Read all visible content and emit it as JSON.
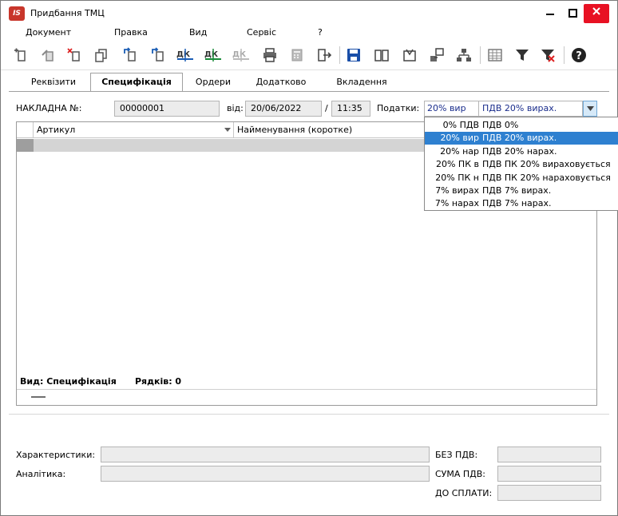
{
  "window": {
    "title": "Придбання ТМЦ",
    "logo_text": "IS",
    "icons": [
      "minimize-icon",
      "maximize-icon",
      "close-icon"
    ]
  },
  "menu": [
    "Документ",
    "Правка",
    "Вид",
    "Сервіс",
    "?"
  ],
  "toolbar": {
    "icons": [
      "new-doc-icon",
      "edit-doc-icon",
      "delete-doc-icon",
      "copy-doc-icon",
      "insert-doc-icon",
      "insert-doc-2-icon",
      "debit-credit-icon",
      "debit-credit-green-icon",
      "debit-credit-disabled-icon",
      "print-icon",
      "calculator-icon",
      "exit-icon",
      "save-icon",
      "book-icon",
      "export-icon",
      "import-icon",
      "hierarchy-icon",
      "table-icon",
      "filter-icon",
      "clear-filter-icon",
      "help-icon"
    ]
  },
  "tabs": [
    "Реквізити",
    "Специфікація",
    "Ордери",
    "Додатково",
    "Вкладення"
  ],
  "active_tab": "Специфікація",
  "header": {
    "invoice_label": "НАКЛАДНА №:",
    "invoice_number": "00000001",
    "date_label": "від:",
    "date_value": "20/06/2022",
    "slash": "/",
    "time_value": "11:35",
    "taxes_label": "Податки:",
    "tax_code": "20% вир",
    "tax_name": "ПДВ 20%  вирах."
  },
  "tax_dropdown": [
    {
      "code": "0% ПДВ",
      "name": "ПДВ 0%",
      "selected": false
    },
    {
      "code": "20% вир",
      "name": "ПДВ 20%  вирах.",
      "selected": true
    },
    {
      "code": "20% нар",
      "name": "ПДВ 20% нарах.",
      "selected": false
    },
    {
      "code": "20% ПК в",
      "name": "ПДВ ПК 20% вираховується",
      "selected": false
    },
    {
      "code": "20% ПК н",
      "name": "ПДВ ПК 20% нараховується",
      "selected": false
    },
    {
      "code": "7% вирах",
      "name": "ПДВ 7% вирах.",
      "selected": false
    },
    {
      "code": "7% нарах",
      "name": "ПДВ 7% нарах.",
      "selected": false
    }
  ],
  "grid": {
    "columns": [
      "Артикул",
      "Найменування (коротке)"
    ],
    "footer_view": "Вид: Специфікація",
    "footer_rows": "Рядків: 0"
  },
  "bottom": {
    "characteristics_label": "Характеристики:",
    "analytics_label": "Аналітика:",
    "no_vat_label": "БЕЗ ПДВ:",
    "vat_sum_label": "СУМА ПДВ:",
    "to_pay_label": "ДО СПЛАТИ:"
  }
}
